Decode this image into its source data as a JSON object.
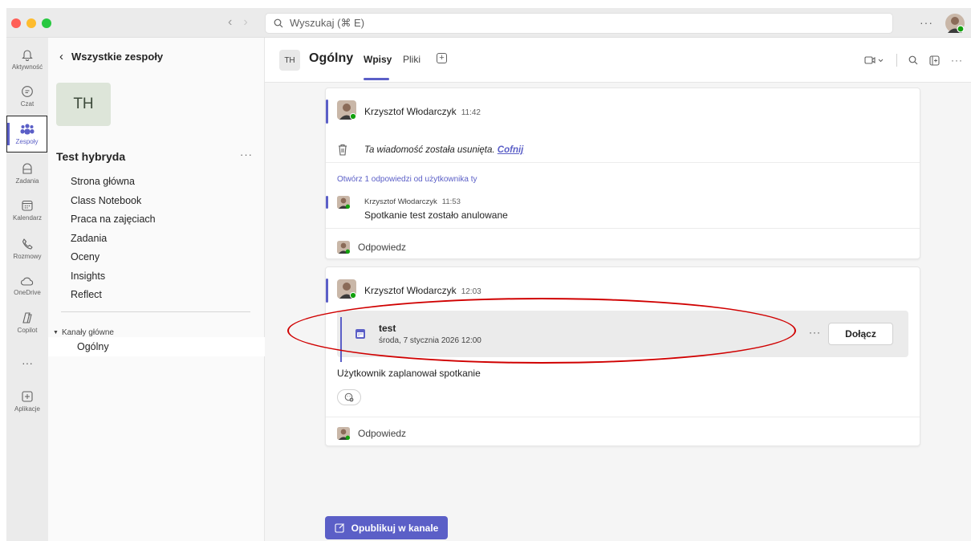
{
  "window": {
    "search_placeholder": "Wyszukaj (⌘ E)",
    "traffic_lights": {
      "close": "#ff5f57",
      "minimize": "#febc2e",
      "zoom": "#28c840"
    }
  },
  "rail": {
    "items": [
      {
        "label": "Aktywność",
        "icon": "bell-icon"
      },
      {
        "label": "Czat",
        "icon": "chat-icon"
      },
      {
        "label": "Zespoły",
        "icon": "teams-icon",
        "active": true
      },
      {
        "label": "Zadania",
        "icon": "assignments-icon"
      },
      {
        "label": "Kalendarz",
        "icon": "calendar-icon"
      },
      {
        "label": "Rozmowy",
        "icon": "phone-icon"
      },
      {
        "label": "OneDrive",
        "icon": "cloud-icon"
      },
      {
        "label": "Copilot",
        "icon": "copilot-icon"
      },
      {
        "label": "Aplikacje",
        "icon": "apps-icon"
      }
    ]
  },
  "left_panel": {
    "back_label": "Wszystkie zespoły",
    "team_initials": "TH",
    "team_name": "Test hybryda",
    "links": [
      "Strona główna",
      "Class Notebook",
      "Praca na zajęciach",
      "Zadania",
      "Oceny",
      "Insights",
      "Reflect"
    ],
    "channels_header": "Kanały główne",
    "channels": [
      "Ogólny"
    ]
  },
  "channel": {
    "initials": "TH",
    "title": "Ogólny",
    "tabs": [
      "Wpisy",
      "Pliki"
    ],
    "active_tab": "Wpisy"
  },
  "posts": [
    {
      "author": "Krzysztof Włodarczyk",
      "time": "11:42",
      "deleted_text": "Ta wiadomość została usunięta.",
      "undo_label": "Cofnij",
      "open_replies": "Otwórz 1 odpowiedzi od użytkownika ty",
      "reply": {
        "author": "Krzysztof Włodarczyk",
        "time": "11:53",
        "text": "Spotkanie test zostało anulowane"
      },
      "reply_label": "Odpowiedz"
    },
    {
      "author": "Krzysztof Włodarczyk",
      "time": "12:03",
      "meeting": {
        "title": "test",
        "date": "środa, 7 stycznia 2026 12:00",
        "join_label": "Dołącz"
      },
      "scheduled_text": "Użytkownik zaplanował spotkanie",
      "reply_label": "Odpowiedz"
    }
  ],
  "publish_label": "Opublikuj w kanale",
  "colors": {
    "accent": "#5b5fc7",
    "annotation": "#d00000",
    "presence": "#13a10e"
  }
}
